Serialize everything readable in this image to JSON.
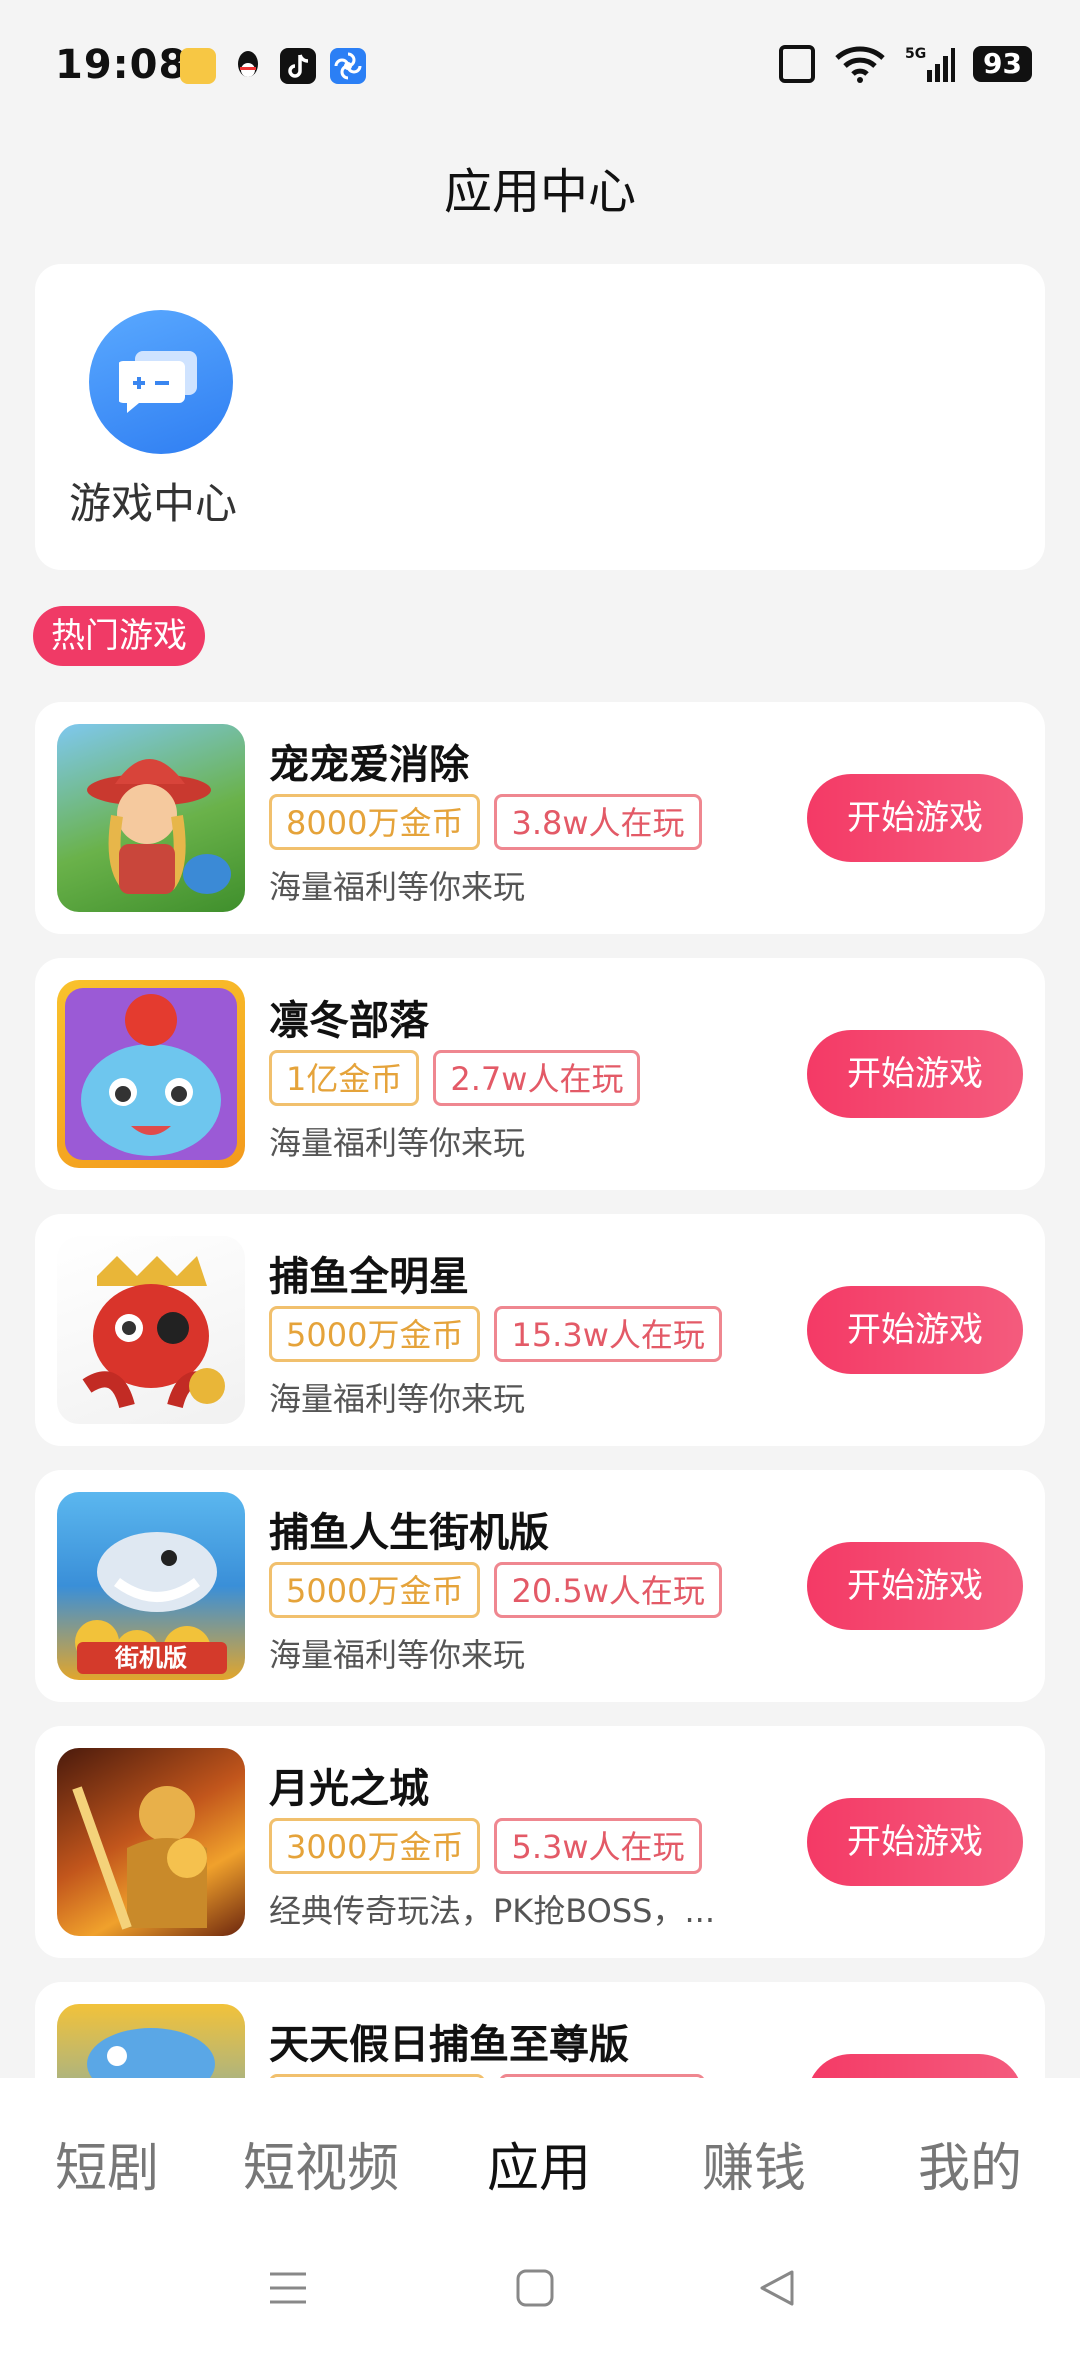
{
  "status_bar": {
    "time": "19:08",
    "battery": "93",
    "network": "5G"
  },
  "header": {
    "title": "应用中心"
  },
  "game_center": {
    "label": "游戏中心",
    "icon": "gamepad-chat-icon"
  },
  "section": {
    "hot_label": "热门游戏"
  },
  "games": [
    {
      "name": "宠宠爱消除",
      "coins": "8000万金币",
      "players": "3.8w人在玩",
      "desc": "海量福利等你来玩",
      "button": "开始游戏"
    },
    {
      "name": "凛冬部落",
      "coins": "1亿金币",
      "players": "2.7w人在玩",
      "desc": "海量福利等你来玩",
      "button": "开始游戏"
    },
    {
      "name": "捕鱼全明星",
      "coins": "5000万金币",
      "players": "15.3w人在玩",
      "desc": "海量福利等你来玩",
      "button": "开始游戏"
    },
    {
      "name": "捕鱼人生街机版",
      "coins": "5000万金币",
      "players": "20.5w人在玩",
      "desc": "海量福利等你来玩",
      "button": "开始游戏"
    },
    {
      "name": "月光之城",
      "coins": "3000万金币",
      "players": "5.3w人在玩",
      "desc": "经典传奇玩法，PK抢BOSS，...",
      "button": "开始游戏"
    },
    {
      "name": "天天假日捕鱼至尊版",
      "coins": "",
      "players": "",
      "desc": "",
      "button": ""
    }
  ],
  "bottom_nav": {
    "items": [
      "短剧",
      "短视频",
      "应用",
      "赚钱",
      "我的"
    ],
    "active": "应用"
  },
  "colors": {
    "accent": "#f03a66",
    "coin_tag": "#e5a33a",
    "players_tag": "#e35a67",
    "game_center_icon": "#2f7ef2"
  }
}
